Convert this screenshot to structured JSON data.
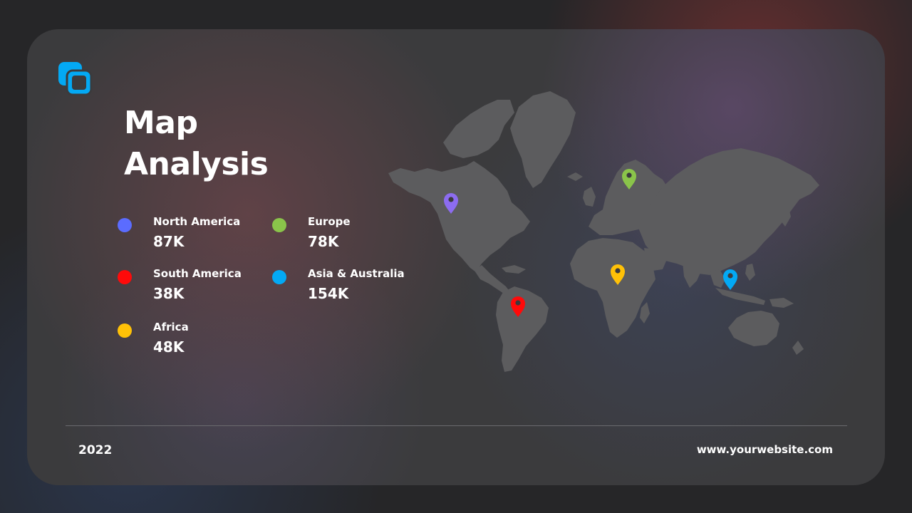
{
  "slide": {
    "title_line1": "Map",
    "title_line2": "Analysis"
  },
  "legend": [
    {
      "label": "North America",
      "value": "87K",
      "color": "#5b6cff"
    },
    {
      "label": "South America",
      "value": "38K",
      "color": "#ff0a0a"
    },
    {
      "label": "Africa",
      "value": "48K",
      "color": "#ffc107"
    },
    {
      "label": "Europe",
      "value": "78K",
      "color": "#8ac44a"
    },
    {
      "label": "Asia & Australia",
      "value": "154K",
      "color": "#03a9f4"
    }
  ],
  "map_pins": [
    {
      "region": "North America",
      "color": "#8c6cf0",
      "icon": "map-pin-icon"
    },
    {
      "region": "South America",
      "color": "#ff0a0a",
      "icon": "map-pin-icon"
    },
    {
      "region": "Africa",
      "color": "#ffc107",
      "icon": "map-pin-icon"
    },
    {
      "region": "Europe",
      "color": "#8ac44a",
      "icon": "map-pin-icon"
    },
    {
      "region": "Asia & Australia",
      "color": "#03a9f4",
      "icon": "map-pin-icon"
    }
  ],
  "footer": {
    "year": "2022",
    "website": "www.yourwebsite.com"
  },
  "colors": {
    "background": "#262628",
    "card": "#3b3b3d",
    "land": "#5c5c5e",
    "accent": "#03a9f4"
  },
  "icons": {
    "logo": "overlapping-squares-logo-icon"
  }
}
